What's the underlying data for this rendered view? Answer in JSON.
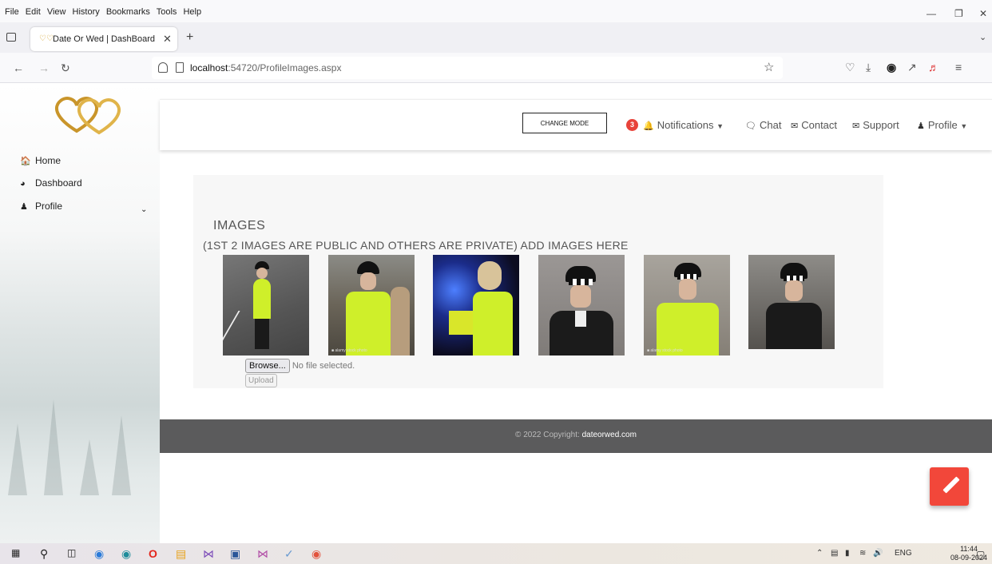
{
  "window": {
    "menu": [
      "File",
      "Edit",
      "View",
      "History",
      "Bookmarks",
      "Tools",
      "Help"
    ],
    "menu_underline": [
      "F",
      "E",
      "V",
      "s",
      "B",
      "T",
      "H"
    ]
  },
  "tab": {
    "title": "Date Or Wed | DashBoard"
  },
  "address": {
    "host": "localhost",
    "rest": ":54720/ProfileImages.aspx"
  },
  "sidebar": {
    "items": [
      {
        "label": "Home",
        "icon": "home-icon"
      },
      {
        "label": "Dashboard",
        "icon": "dashboard-icon"
      },
      {
        "label": "Profile",
        "icon": "users-icon"
      }
    ]
  },
  "header": {
    "change_mode": "CHANGE MODE",
    "notif_count": "3",
    "notifications": "Notifications",
    "chat": "Chat",
    "contact": "Contact",
    "support": "Support",
    "profile": "Profile"
  },
  "images_panel": {
    "title": "IMAGES",
    "subtitle": "(1ST 2 IMAGES ARE PUBLIC AND OTHERS ARE PRIVATE) ADD IMAGES HERE",
    "browse_label": "Browse...",
    "file_status": "No file selected.",
    "upload_label": "Upload",
    "image_count": 6
  },
  "footer": {
    "prefix": "© 2022 Copyright:",
    "site": "dateorwed.com"
  },
  "taskbar": {
    "language": "ENG",
    "time": "11:44",
    "date": "08-09-2024"
  },
  "colors": {
    "accent_red": "#f2473a",
    "footer_gray": "#5b5b5c",
    "hi_vis": "#cfef2a",
    "badge_red": "#e8433a"
  }
}
